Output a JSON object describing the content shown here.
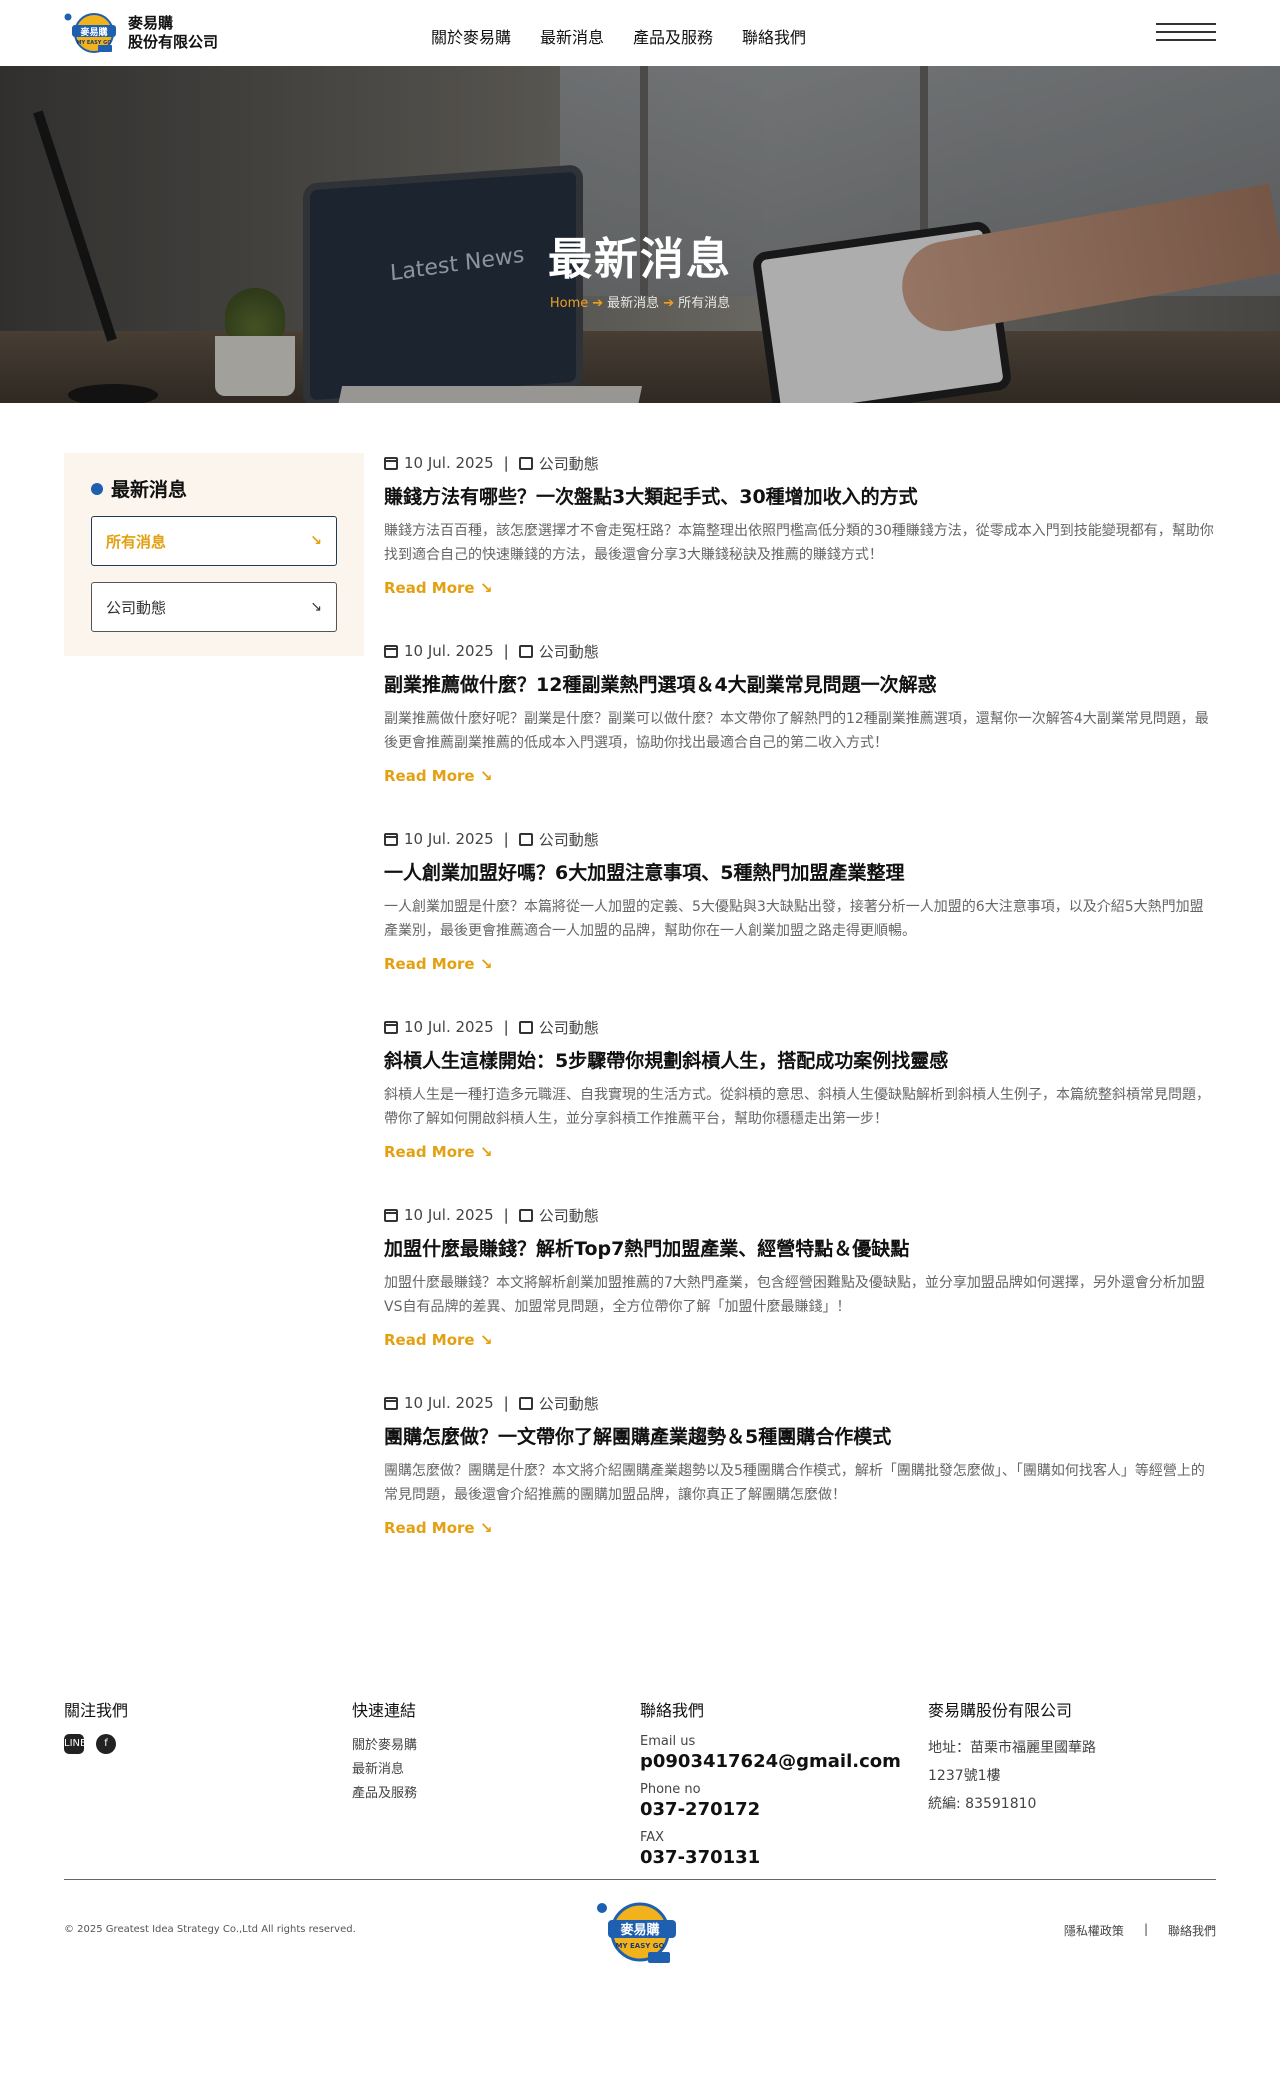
{
  "header": {
    "logo_line1": "麥易購",
    "logo_line2": "股份有限公司",
    "logo_badge": "麥易購",
    "logo_badge_sub": "MY EASY GO",
    "nav": [
      "關於麥易購",
      "最新消息",
      "產品及服務",
      "聯絡我們"
    ]
  },
  "banner": {
    "title": "最新消息",
    "laptop_text": "Latest News",
    "crumb_home": "Home",
    "crumb_1": "最新消息",
    "crumb_2": "所有消息",
    "crumb_sep": "➔"
  },
  "sidebar": {
    "title": "最新消息",
    "items": [
      {
        "label": "所有消息",
        "arrow": "↘"
      },
      {
        "label": "公司動態",
        "arrow": "↘"
      }
    ]
  },
  "posts": [
    {
      "date": "10 Jul. 2025",
      "category": "公司動態",
      "title": "賺錢方法有哪些？一次盤點3大類起手式、30種增加收入的方式",
      "excerpt": "賺錢方法百百種，該怎麼選擇才不會走冤枉路？本篇整理出依照門檻高低分類的30種賺錢方法，從零成本入門到技能變現都有，幫助你找到適合自己的快速賺錢的方法，最後還會分享3大賺錢秘訣及推薦的賺錢方式！",
      "more": "Read More ↘"
    },
    {
      "date": "10 Jul. 2025",
      "category": "公司動態",
      "title": "副業推薦做什麼？12種副業熱門選項＆4大副業常見問題一次解惑",
      "excerpt": "副業推薦做什麼好呢？副業是什麼？副業可以做什麼？本文帶你了解熱門的12種副業推薦選項，還幫你一次解答4大副業常見問題，最後更會推薦副業推薦的低成本入門選項，協助你找出最適合自己的第二收入方式！",
      "more": "Read More ↘"
    },
    {
      "date": "10 Jul. 2025",
      "category": "公司動態",
      "title": "一人創業加盟好嗎？6大加盟注意事項、5種熱門加盟產業整理",
      "excerpt": "一人創業加盟是什麼？本篇將從一人加盟的定義、5大優點與3大缺點出發，接著分析一人加盟的6大注意事項，以及介紹5大熱門加盟產業別，最後更會推薦適合一人加盟的品牌，幫助你在一人創業加盟之路走得更順暢。",
      "more": "Read More ↘"
    },
    {
      "date": "10 Jul. 2025",
      "category": "公司動態",
      "title": "斜槓人生這樣開始：5步驟帶你規劃斜槓人生，搭配成功案例找靈感",
      "excerpt": "斜槓人生是一種打造多元職涯、自我實現的生活方式。從斜槓的意思、斜槓人生優缺點解析到斜槓人生例子，本篇統整斜槓常見問題，帶你了解如何開啟斜槓人生，並分享斜槓工作推薦平台，幫助你穩穩走出第一步！",
      "more": "Read More ↘"
    },
    {
      "date": "10 Jul. 2025",
      "category": "公司動態",
      "title": "加盟什麼最賺錢？解析Top7熱門加盟產業、經營特點＆優缺點",
      "excerpt": "加盟什麼最賺錢？本文將解析創業加盟推薦的7大熱門產業，包含經營困難點及優缺點，並分享加盟品牌如何選擇，另外還會分析加盟VS自有品牌的差異、加盟常見問題，全方位帶你了解「加盟什麼最賺錢」！",
      "more": "Read More ↘"
    },
    {
      "date": "10 Jul. 2025",
      "category": "公司動態",
      "title": "團購怎麼做？一文帶你了解團購產業趨勢＆5種團購合作模式",
      "excerpt": "團購怎麼做？團購是什麼？本文將介紹團購產業趨勢以及5種團購合作模式，解析「團購批發怎麼做」、「團購如何找客人」等經營上的常見問題，最後還會介紹推薦的團購加盟品牌，讓你真正了解團購怎麼做！",
      "more": "Read More ↘"
    }
  ],
  "footer": {
    "follow_title": "關注我們",
    "quick_title": "快速連結",
    "quick_links": [
      "關於麥易購",
      "最新消息",
      "產品及服務"
    ],
    "contact_title": "聯絡我們",
    "email_label": "Email us",
    "email": "p0903417624@gmail.com",
    "phone_label": "Phone no",
    "phone": "037-270172",
    "fax_label": "FAX",
    "fax": "037-370131",
    "company_title": "麥易購股份有限公司",
    "addr1": "地址：苗栗市福麗里國華路",
    "addr2": "1237號1樓",
    "taxid": "統編: 83591810",
    "copyright": "© 2025 Greatest Idea Strategy Co.,Ltd All rights reserved.",
    "privacy": "隱私權政策",
    "divider": "|",
    "contact_link": "聯絡我們",
    "line_icon": "LINE",
    "fb_icon": "f"
  },
  "colors": {
    "accent": "#e2a012",
    "brand_blue": "#1e5fb0",
    "sidebar_bg": "#fbf5ee"
  }
}
